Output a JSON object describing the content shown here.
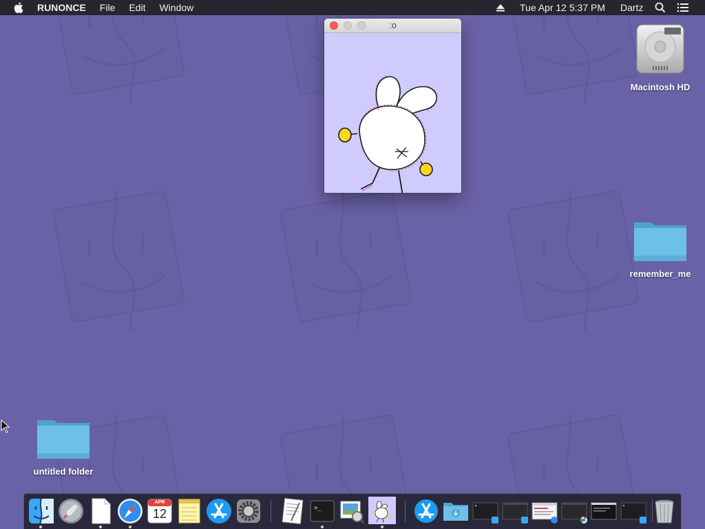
{
  "menubar": {
    "apple_icon": "apple-icon",
    "app_name": "RUNONCE",
    "menus": [
      "File",
      "Edit",
      "Window"
    ],
    "clock": "Tue Apr 12  5:37 PM",
    "user": "Dartz",
    "status_icons": [
      "eject-icon",
      "search-icon",
      "list-icon"
    ]
  },
  "window": {
    "title": ":o",
    "background": "#cfcbfd"
  },
  "desktop": {
    "wallpaper_color": "#6a62a6",
    "icons": [
      {
        "label": "Macintosh HD",
        "icon": "hard-drive-icon"
      },
      {
        "label": "remember_me",
        "icon": "folder-icon"
      },
      {
        "label": "untitled folder",
        "icon": "folder-icon"
      }
    ]
  },
  "dock": {
    "calendar_month": "APR",
    "calendar_day": "12",
    "items": [
      "finder-icon",
      "launchpad-icon",
      "document-icon",
      "safari-icon",
      "calendar-icon",
      "notes-icon",
      "app-store-icon",
      "system-preferences-icon",
      "textedit-icon",
      "terminal-icon",
      "preview-icon",
      "bunny-app-icon",
      "app-store-icon",
      "downloads-folder-icon",
      "minimized-window-icon",
      "minimized-window-icon",
      "minimized-window-icon",
      "minimized-window-icon",
      "minimized-window-icon",
      "minimized-window-icon",
      "trash-icon"
    ]
  }
}
